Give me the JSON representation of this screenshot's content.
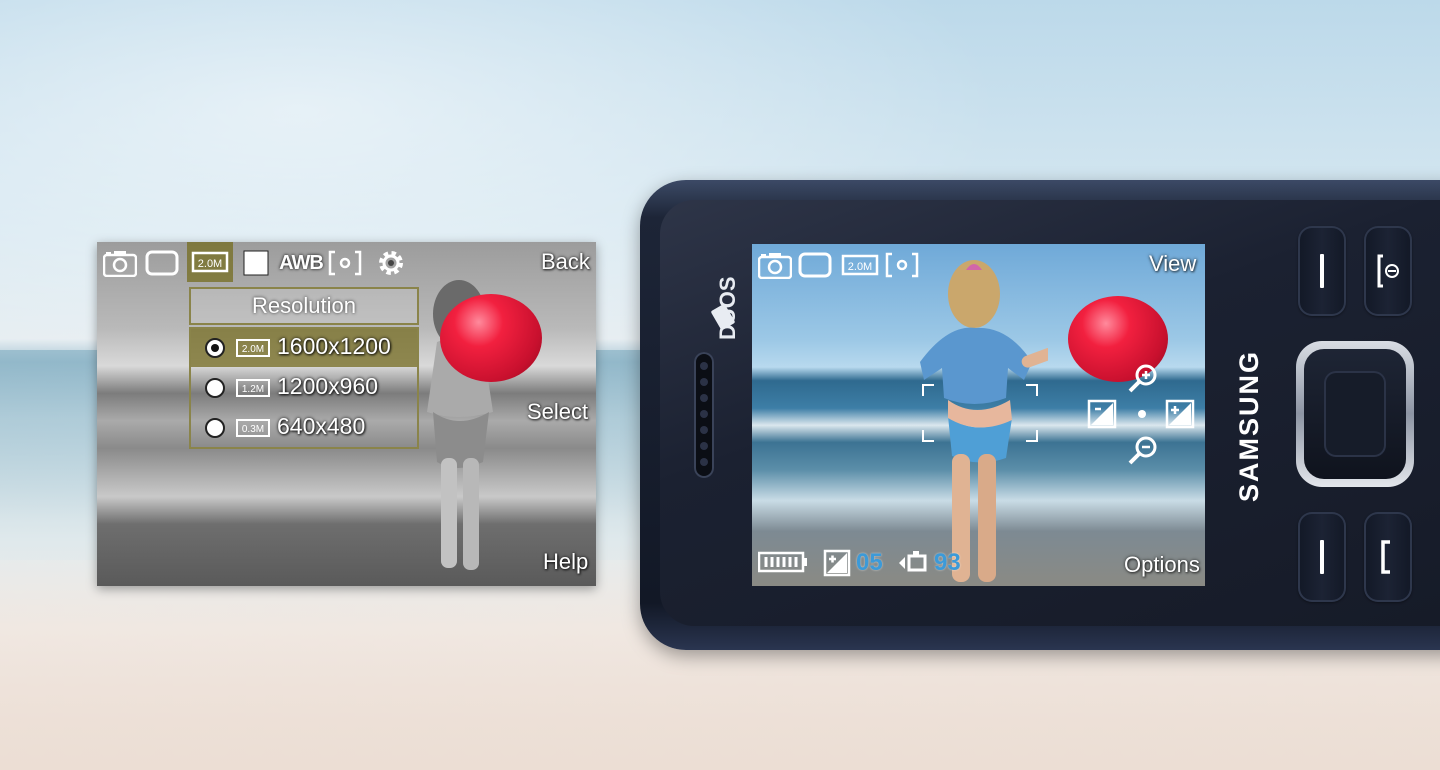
{
  "settings_screen": {
    "top_icons": [
      "camera-icon",
      "single-shot-icon",
      "resolution-2m-icon",
      "white-square-icon",
      "awb-icon",
      "focus-mode-icon",
      "settings-gear-icon"
    ],
    "awb_label": "AWB",
    "resolution_badge": "2.0M",
    "back_label": "Back",
    "select_label": "Select",
    "help_label": "Help",
    "popup_title": "Resolution",
    "options": [
      {
        "badge": "2.0M",
        "label": "1600x1200",
        "selected": true
      },
      {
        "badge": "1.2M",
        "label": "1200x960",
        "selected": false
      },
      {
        "badge": "0.3M",
        "label": "640x480",
        "selected": false
      }
    ]
  },
  "phone": {
    "brand": "SAMSUNG",
    "duos_label": "DUOS",
    "screen": {
      "top_icons": [
        "camera-icon",
        "single-shot-icon",
        "resolution-2m-icon",
        "focus-mode-icon"
      ],
      "resolution_badge": "2.0M",
      "view_label": "View",
      "options_label": "Options",
      "exposure_value": "05",
      "shots_remaining": "93",
      "right_controls": [
        "zoom-in-icon",
        "exposure-minus-icon",
        "exposure-plus-icon",
        "zoom-out-icon"
      ]
    },
    "keys": [
      "left-softkey-top",
      "right-softkey-top",
      "dpad",
      "left-softkey-bottom",
      "right-softkey-bottom"
    ]
  },
  "colors": {
    "balloon": "#d6122f",
    "selection": "#7a7232",
    "popup_border": "#8a844a",
    "status_blue": "#3c9ad8",
    "phone_body": "#161b28"
  }
}
